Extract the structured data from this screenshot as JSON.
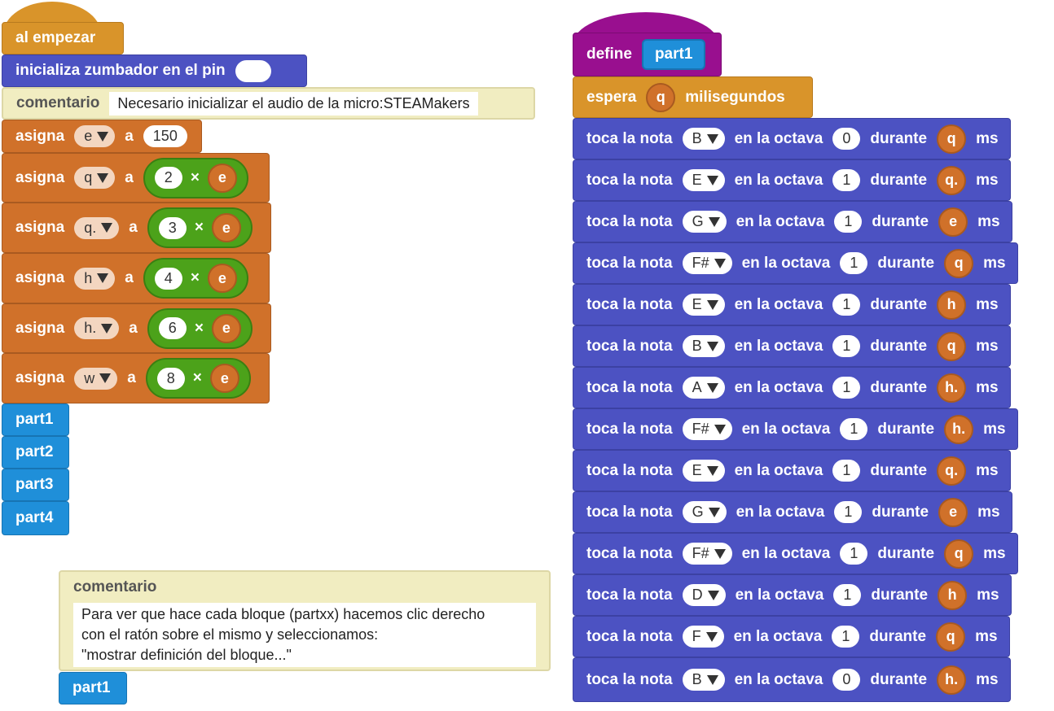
{
  "colors": {
    "events": "#d9942a",
    "buzzer": "#4c52c2",
    "variables": "#d0712a",
    "operators": "#4ca21a",
    "my_blocks": "#1f8fd9",
    "define": "#990f8f",
    "comment": "#f1edc1"
  },
  "start_script": {
    "hat_label": "al empezar",
    "init_buzzer_label": "inicializa zumbador en el pin",
    "comment_label": "comentario",
    "comment_text": "Necesario inicializar el audio de la micro:STEAMakers",
    "assign_label": "asigna",
    "to_label": "a",
    "times_symbol": "×",
    "assign_e": {
      "var": "e",
      "value": "150"
    },
    "assign_q": {
      "var": "q",
      "mult": "2",
      "ref": "e"
    },
    "assign_qdot": {
      "var": "q.",
      "mult": "3",
      "ref": "e"
    },
    "assign_h": {
      "var": "h",
      "mult": "4",
      "ref": "e"
    },
    "assign_hdot": {
      "var": "h.",
      "mult": "6",
      "ref": "e"
    },
    "assign_w": {
      "var": "w",
      "mult": "8",
      "ref": "e"
    },
    "calls": [
      "part1",
      "part2",
      "part3",
      "part4"
    ]
  },
  "help_comment": {
    "title": "comentario",
    "text": "Para ver que hace cada bloque (partxx) hacemos clic derecho\ncon el ratón sobre el mismo y seleccionamos:\n\"mostrar definición del bloque...\"",
    "call_label": "part1"
  },
  "define_script": {
    "define_label": "define",
    "block_name": "part1",
    "wait_label": "espera",
    "wait_arg": "q",
    "wait_unit": "milisegundos",
    "note_prefix": "toca la nota",
    "octave_label": "en la octava",
    "during_label": "durante",
    "ms_label": "ms",
    "notes": [
      {
        "note": "B",
        "octave": "0",
        "dur": "q"
      },
      {
        "note": "E",
        "octave": "1",
        "dur": "q."
      },
      {
        "note": "G",
        "octave": "1",
        "dur": "e"
      },
      {
        "note": "F#",
        "octave": "1",
        "dur": "q"
      },
      {
        "note": "E",
        "octave": "1",
        "dur": "h"
      },
      {
        "note": "B",
        "octave": "1",
        "dur": "q"
      },
      {
        "note": "A",
        "octave": "1",
        "dur": "h."
      },
      {
        "note": "F#",
        "octave": "1",
        "dur": "h."
      },
      {
        "note": "E",
        "octave": "1",
        "dur": "q."
      },
      {
        "note": "G",
        "octave": "1",
        "dur": "e"
      },
      {
        "note": "F#",
        "octave": "1",
        "dur": "q"
      },
      {
        "note": "D",
        "octave": "1",
        "dur": "h"
      },
      {
        "note": "F",
        "octave": "1",
        "dur": "q"
      },
      {
        "note": "B",
        "octave": "0",
        "dur": "h."
      }
    ]
  }
}
